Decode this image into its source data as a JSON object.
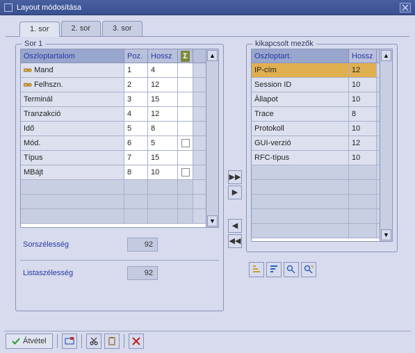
{
  "window": {
    "title": "Layout módosítása"
  },
  "tabs": [
    "1. sor",
    "2. sor",
    "3. sor"
  ],
  "activeTab": 0,
  "leftGroup": {
    "title": "Sor 1",
    "headers": {
      "content": "Oszloptartalom",
      "pos": "Poz.",
      "len": "Hossz",
      "sum": "Σ"
    },
    "rows": [
      {
        "icon": "key",
        "name": "Mand",
        "pos": "1",
        "len": "4",
        "chk": null
      },
      {
        "icon": "key",
        "name": "Felhszn.",
        "pos": "2",
        "len": "12",
        "chk": null
      },
      {
        "icon": null,
        "name": "Terminál",
        "pos": "3",
        "len": "15",
        "chk": null
      },
      {
        "icon": null,
        "name": "Tranzakció",
        "pos": "4",
        "len": "12",
        "chk": null
      },
      {
        "icon": null,
        "name": "Idő",
        "pos": "5",
        "len": "8",
        "chk": null
      },
      {
        "icon": null,
        "name": "Mód.",
        "pos": "6",
        "len": "5",
        "chk": false
      },
      {
        "icon": null,
        "name": "Típus",
        "pos": "7",
        "len": "15",
        "chk": null
      },
      {
        "icon": null,
        "name": "MBájt",
        "pos": "8",
        "len": "10",
        "chk": false
      }
    ],
    "sorWidthLabel": "Sorszélesség",
    "sorWidthValue": "92",
    "listWidthLabel": "Listaszélesség",
    "listWidthValue": "92"
  },
  "rightGroup": {
    "title": "kikapcsolt mezők",
    "headers": {
      "content": "Oszloptart.",
      "len": "Hossz"
    },
    "rows": [
      {
        "name": "IP-cím",
        "len": "12",
        "selected": true
      },
      {
        "name": "Session ID",
        "len": "10",
        "selected": false
      },
      {
        "name": "Állapot",
        "len": "10",
        "selected": false
      },
      {
        "name": "Trace",
        "len": "8",
        "selected": false
      },
      {
        "name": "Protokoll",
        "len": "10",
        "selected": false
      },
      {
        "name": "GUI-verzió",
        "len": "12",
        "selected": false
      },
      {
        "name": "RFC-típus",
        "len": "10",
        "selected": false
      }
    ]
  },
  "bottomBar": {
    "accept": "Átvétel"
  }
}
